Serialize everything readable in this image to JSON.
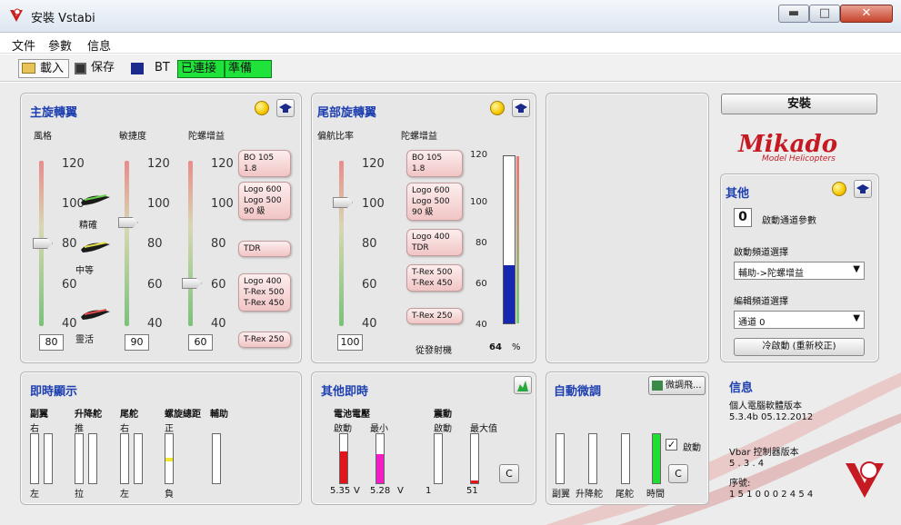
{
  "window": {
    "title": "安裝 Vstabi"
  },
  "menu": [
    "文件",
    "參數",
    "信息"
  ],
  "toolbar": {
    "load": "載入",
    "save": "保存",
    "bt": "BT",
    "connected": "已連接",
    "ready": "準備"
  },
  "main_rotor": {
    "title": "主旋轉翼",
    "labels": {
      "style": "風格",
      "agility": "敏捷度",
      "gyro": "陀螺增益"
    },
    "ticks": [
      "120",
      "100",
      "80",
      "60",
      "40"
    ],
    "style_value": "80",
    "agility_value": "90",
    "gyro_value": "60",
    "style_modes": [
      "精確",
      "中等",
      "靈活"
    ],
    "bubbles": [
      "BO 105 1.8",
      "Logo 600\nLogo 500\n90 級",
      "TDR",
      "Logo 400\nT-Rex 500\nT-Rex 450",
      "T-Rex 250"
    ]
  },
  "tail_rotor": {
    "title": "尾部旋轉翼",
    "labels": {
      "yaw_ratio": "偏航比率",
      "gyro": "陀螺增益"
    },
    "ticks": [
      "120",
      "100",
      "80",
      "60",
      "40"
    ],
    "yaw_value": "100",
    "bubbles": [
      "BO 105 1.8",
      "Logo 600\nLogo 500\n90 級",
      "Logo 400\nTDR",
      "T-Rex 500\nT-Rex 450",
      "T-Rex 250"
    ],
    "transmitter_label": "從發射機",
    "transmitter_value": "64",
    "transmitter_unit": "%",
    "gyro_fill": 0.35
  },
  "side": {
    "install_button": "安裝",
    "logo_text": "Mikado",
    "logo_sub": "Model Helicopters",
    "other": {
      "title": "其他",
      "channel_value": "0",
      "channel_label": "啟動通道參數",
      "startup_select_label": "啟動頻道選擇",
      "startup_select_value": "輔助->陀螺增益",
      "edit_select_label": "編輯頻道選擇",
      "edit_select_value": "通道 0",
      "cold_start": "冷啟動 (重新校正)"
    },
    "info": {
      "title": "信息",
      "pc_version_label": "個人電腦軟體版本",
      "pc_version": "5.3.4b  05.12.2012",
      "vbar_label": "Vbar 控制器版本",
      "vbar_version": "5 . 3 . 4",
      "serial_label": "序號:",
      "serial": "1 5 1 0 0 0 2 4 5 4"
    }
  },
  "realtime": {
    "title": "即時顯示",
    "groups": [
      {
        "label": "副翼",
        "top": "右",
        "bottom": "左"
      },
      {
        "label": "升降舵",
        "top": "推",
        "bottom": "拉"
      },
      {
        "label": "尾舵",
        "top": "右",
        "bottom": "左"
      },
      {
        "label": "螺旋總距",
        "top": "正",
        "bottom": "負"
      },
      {
        "label": "輔助",
        "top": "",
        "bottom": ""
      }
    ]
  },
  "other_realtime": {
    "title": "其他即時",
    "voltage_label": "電池電壓",
    "vib_label": "震動",
    "startup": "啟動",
    "min": "最小",
    "max": "最大值",
    "v1": "5.35",
    "v2": "5.28",
    "unit": "V",
    "vib1": "1",
    "vib2": "51",
    "clear": "C"
  },
  "auto_trim": {
    "title": "自動微調",
    "trim_flight": "微調飛...",
    "enable": "啟動",
    "clear": "C",
    "labels": [
      "副翼",
      "升降舵",
      "尾舵",
      "時間"
    ]
  }
}
